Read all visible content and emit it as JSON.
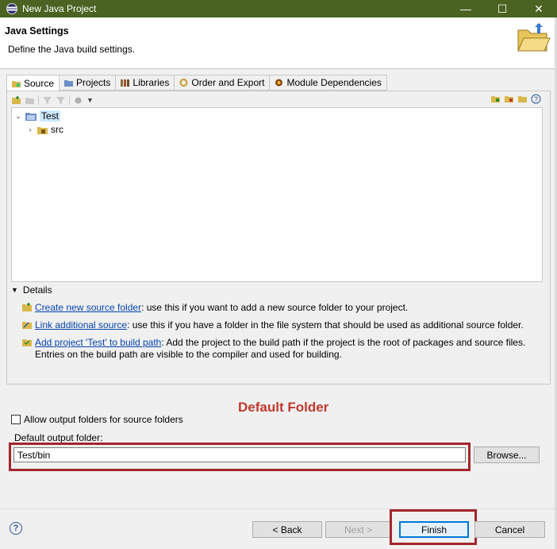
{
  "window": {
    "title": "New Java Project",
    "minimize_glyph": "—",
    "maximize_glyph": "☐",
    "close_glyph": "✕"
  },
  "header": {
    "title": "Java Settings",
    "description": "Define the Java build settings."
  },
  "tabs": [
    {
      "label": "Source",
      "icon": "source-folder-icon",
      "active": true
    },
    {
      "label": "Projects",
      "icon": "projects-icon",
      "active": false
    },
    {
      "label": "Libraries",
      "icon": "library-icon",
      "active": false
    },
    {
      "label": "Order and Export",
      "icon": "order-export-icon",
      "active": false
    },
    {
      "label": "Module Dependencies",
      "icon": "module-icon",
      "active": false
    }
  ],
  "tree": {
    "root": {
      "label": "Test",
      "expanded": true
    },
    "child": {
      "label": "src",
      "expanded": false
    }
  },
  "details": {
    "header": "Details",
    "items": [
      {
        "link": "Create new source folder",
        "text": ": use this if you want to add a new source folder to your project."
      },
      {
        "link": "Link additional source",
        "text": ": use this if you have a folder in the file system that should be used as additional source folder."
      },
      {
        "link": "Add project 'Test' to build path",
        "text": ": Add the project to the build path if the project is the root of packages and source files. Entries on the build path are visible to the compiler and used for building."
      }
    ]
  },
  "annotation": {
    "title": "Default Folder",
    "color": "#c0392b"
  },
  "output": {
    "allow_label": "Allow output folders for source folders",
    "allow_checked": false,
    "folder_label": "Default output folder:",
    "folder_value": "Test/bin",
    "browse_label": "Browse..."
  },
  "buttons": {
    "back": "< Back",
    "next": "Next >",
    "finish": "Finish",
    "cancel": "Cancel",
    "help_glyph": "?"
  }
}
